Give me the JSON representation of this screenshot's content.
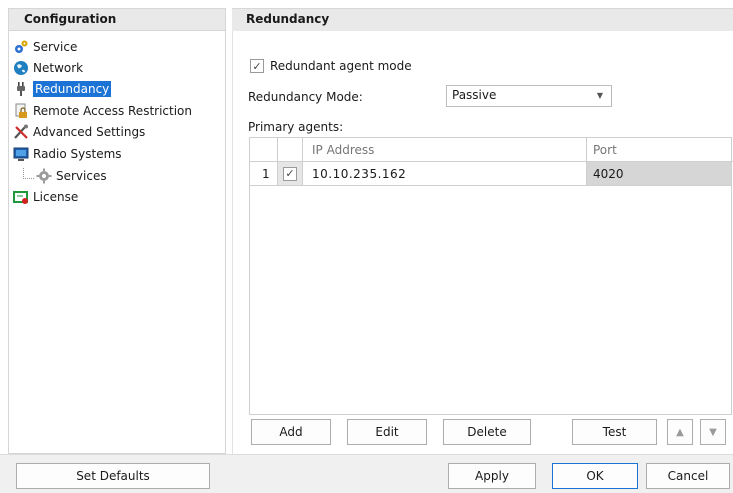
{
  "left_panel": {
    "header": "Configuration",
    "items": [
      {
        "label": "Service",
        "icon": "gears-icon"
      },
      {
        "label": "Network",
        "icon": "globe-icon"
      },
      {
        "label": "Redundancy",
        "icon": "plug-icon",
        "selected": true
      },
      {
        "label": "Remote Access Restriction",
        "icon": "lock-document-icon"
      },
      {
        "label": "Advanced Settings",
        "icon": "tools-icon"
      },
      {
        "label": "Radio Systems",
        "icon": "radio-computer-icon"
      },
      {
        "label": "Services",
        "icon": "gear-icon",
        "child": true
      },
      {
        "label": "License",
        "icon": "license-icon"
      }
    ]
  },
  "right_panel": {
    "header": "Redundancy",
    "redundant_mode_label": "Redundant agent mode",
    "redundant_mode_checked": true,
    "redundancy_mode_label": "Redundancy Mode:",
    "redundancy_mode_value": "Passive",
    "primary_agents_label": "Primary agents:",
    "table": {
      "columns": [
        "IP Address",
        "Port"
      ],
      "rows": [
        {
          "index": "1",
          "checked": true,
          "ip": "10.10.235.162",
          "port": "4020"
        }
      ]
    },
    "buttons": {
      "add": "Add",
      "edit": "Edit",
      "delete": "Delete",
      "test": "Test",
      "up": "▲",
      "down": "▼"
    }
  },
  "footer": {
    "set_defaults": "Set Defaults",
    "apply": "Apply",
    "ok": "OK",
    "cancel": "Cancel"
  },
  "colors": {
    "selection": "#1b73d6",
    "header_bg": "#e9e9e9"
  }
}
